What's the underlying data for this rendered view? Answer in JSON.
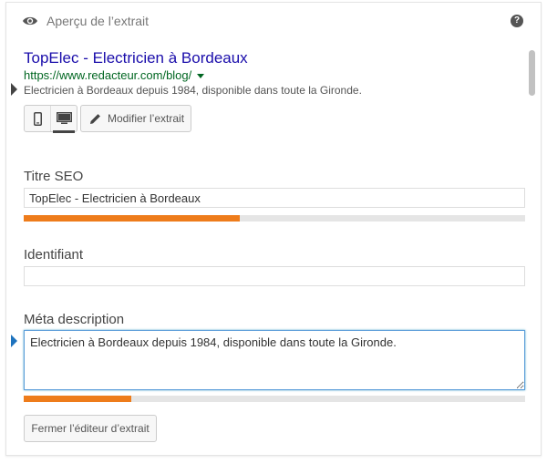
{
  "header": {
    "title": "Aperçu de l’extrait",
    "help_label": "?"
  },
  "preview": {
    "title": "TopElec - Electricien à Bordeaux",
    "url": "https://www.redacteur.com/blog/",
    "description": "Electricien à Bordeaux depuis 1984, disponible dans toute la Gironde."
  },
  "toolbar": {
    "mobile_icon": "mobile-icon",
    "desktop_icon": "desktop-icon",
    "modify_label": "Modifier l’extrait"
  },
  "seo_title": {
    "label": "Titre SEO",
    "value": "TopElec - Electricien à Bordeaux",
    "progress": 0.43
  },
  "slug": {
    "label": "Identifiant",
    "value": ""
  },
  "meta": {
    "label": "Méta description",
    "value": "Electricien à Bordeaux depuis 1984, disponible dans toute la Gironde.",
    "progress": 0.215
  },
  "close_label": "Fermer l’éditeur d’extrait",
  "colors": {
    "link": "#1a0dab",
    "url": "#006621",
    "progress": "#ee7c1b",
    "focus": "#5b9dd9"
  }
}
